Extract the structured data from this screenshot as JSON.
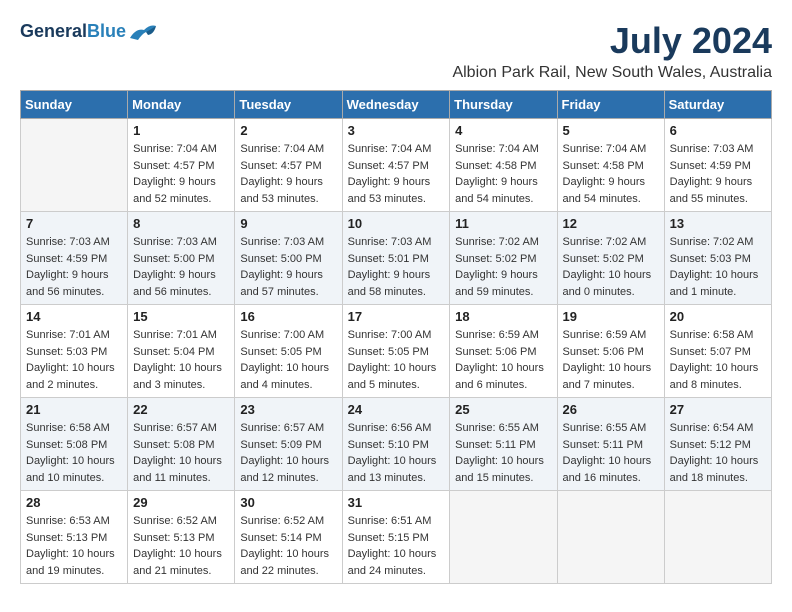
{
  "header": {
    "logo_line1": "General",
    "logo_line2": "Blue",
    "month": "July 2024",
    "location": "Albion Park Rail, New South Wales, Australia"
  },
  "days_of_week": [
    "Sunday",
    "Monday",
    "Tuesday",
    "Wednesday",
    "Thursday",
    "Friday",
    "Saturday"
  ],
  "weeks": [
    [
      {
        "day": "",
        "info": ""
      },
      {
        "day": "1",
        "info": "Sunrise: 7:04 AM\nSunset: 4:57 PM\nDaylight: 9 hours\nand 52 minutes."
      },
      {
        "day": "2",
        "info": "Sunrise: 7:04 AM\nSunset: 4:57 PM\nDaylight: 9 hours\nand 53 minutes."
      },
      {
        "day": "3",
        "info": "Sunrise: 7:04 AM\nSunset: 4:57 PM\nDaylight: 9 hours\nand 53 minutes."
      },
      {
        "day": "4",
        "info": "Sunrise: 7:04 AM\nSunset: 4:58 PM\nDaylight: 9 hours\nand 54 minutes."
      },
      {
        "day": "5",
        "info": "Sunrise: 7:04 AM\nSunset: 4:58 PM\nDaylight: 9 hours\nand 54 minutes."
      },
      {
        "day": "6",
        "info": "Sunrise: 7:03 AM\nSunset: 4:59 PM\nDaylight: 9 hours\nand 55 minutes."
      }
    ],
    [
      {
        "day": "7",
        "info": "Sunrise: 7:03 AM\nSunset: 4:59 PM\nDaylight: 9 hours\nand 56 minutes."
      },
      {
        "day": "8",
        "info": "Sunrise: 7:03 AM\nSunset: 5:00 PM\nDaylight: 9 hours\nand 56 minutes."
      },
      {
        "day": "9",
        "info": "Sunrise: 7:03 AM\nSunset: 5:00 PM\nDaylight: 9 hours\nand 57 minutes."
      },
      {
        "day": "10",
        "info": "Sunrise: 7:03 AM\nSunset: 5:01 PM\nDaylight: 9 hours\nand 58 minutes."
      },
      {
        "day": "11",
        "info": "Sunrise: 7:02 AM\nSunset: 5:02 PM\nDaylight: 9 hours\nand 59 minutes."
      },
      {
        "day": "12",
        "info": "Sunrise: 7:02 AM\nSunset: 5:02 PM\nDaylight: 10 hours\nand 0 minutes."
      },
      {
        "day": "13",
        "info": "Sunrise: 7:02 AM\nSunset: 5:03 PM\nDaylight: 10 hours\nand 1 minute."
      }
    ],
    [
      {
        "day": "14",
        "info": "Sunrise: 7:01 AM\nSunset: 5:03 PM\nDaylight: 10 hours\nand 2 minutes."
      },
      {
        "day": "15",
        "info": "Sunrise: 7:01 AM\nSunset: 5:04 PM\nDaylight: 10 hours\nand 3 minutes."
      },
      {
        "day": "16",
        "info": "Sunrise: 7:00 AM\nSunset: 5:05 PM\nDaylight: 10 hours\nand 4 minutes."
      },
      {
        "day": "17",
        "info": "Sunrise: 7:00 AM\nSunset: 5:05 PM\nDaylight: 10 hours\nand 5 minutes."
      },
      {
        "day": "18",
        "info": "Sunrise: 6:59 AM\nSunset: 5:06 PM\nDaylight: 10 hours\nand 6 minutes."
      },
      {
        "day": "19",
        "info": "Sunrise: 6:59 AM\nSunset: 5:06 PM\nDaylight: 10 hours\nand 7 minutes."
      },
      {
        "day": "20",
        "info": "Sunrise: 6:58 AM\nSunset: 5:07 PM\nDaylight: 10 hours\nand 8 minutes."
      }
    ],
    [
      {
        "day": "21",
        "info": "Sunrise: 6:58 AM\nSunset: 5:08 PM\nDaylight: 10 hours\nand 10 minutes."
      },
      {
        "day": "22",
        "info": "Sunrise: 6:57 AM\nSunset: 5:08 PM\nDaylight: 10 hours\nand 11 minutes."
      },
      {
        "day": "23",
        "info": "Sunrise: 6:57 AM\nSunset: 5:09 PM\nDaylight: 10 hours\nand 12 minutes."
      },
      {
        "day": "24",
        "info": "Sunrise: 6:56 AM\nSunset: 5:10 PM\nDaylight: 10 hours\nand 13 minutes."
      },
      {
        "day": "25",
        "info": "Sunrise: 6:55 AM\nSunset: 5:11 PM\nDaylight: 10 hours\nand 15 minutes."
      },
      {
        "day": "26",
        "info": "Sunrise: 6:55 AM\nSunset: 5:11 PM\nDaylight: 10 hours\nand 16 minutes."
      },
      {
        "day": "27",
        "info": "Sunrise: 6:54 AM\nSunset: 5:12 PM\nDaylight: 10 hours\nand 18 minutes."
      }
    ],
    [
      {
        "day": "28",
        "info": "Sunrise: 6:53 AM\nSunset: 5:13 PM\nDaylight: 10 hours\nand 19 minutes."
      },
      {
        "day": "29",
        "info": "Sunrise: 6:52 AM\nSunset: 5:13 PM\nDaylight: 10 hours\nand 21 minutes."
      },
      {
        "day": "30",
        "info": "Sunrise: 6:52 AM\nSunset: 5:14 PM\nDaylight: 10 hours\nand 22 minutes."
      },
      {
        "day": "31",
        "info": "Sunrise: 6:51 AM\nSunset: 5:15 PM\nDaylight: 10 hours\nand 24 minutes."
      },
      {
        "day": "",
        "info": ""
      },
      {
        "day": "",
        "info": ""
      },
      {
        "day": "",
        "info": ""
      }
    ]
  ]
}
